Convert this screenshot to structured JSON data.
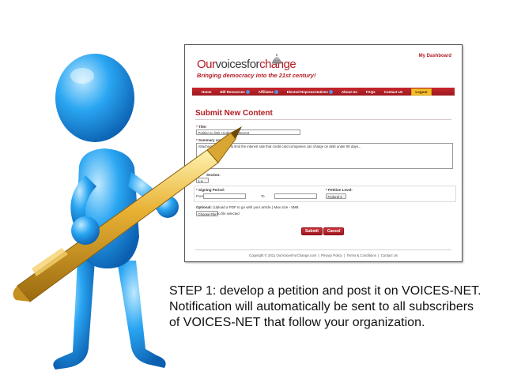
{
  "site": {
    "logo": {
      "our": "Our",
      "voices": "voices",
      "for": "for",
      "change": "change",
      "tagline": "Bringing democracy into the 21st century!"
    },
    "dashboard_link": "My Dashboard",
    "nav": [
      {
        "label": "Home",
        "badge": false
      },
      {
        "label": "Bill Resources",
        "badge": true
      },
      {
        "label": "Affiliates",
        "badge": true
      },
      {
        "label": "Elected Representatives",
        "badge": true
      },
      {
        "label": "About Us",
        "badge": false
      },
      {
        "label": "FAQs",
        "badge": false
      },
      {
        "label": "Contact Us",
        "badge": false
      }
    ],
    "logout_label": "Logout"
  },
  "form": {
    "title": "Submit New Content",
    "title_label": "Title:",
    "title_value": "Petition to limit credit card interest",
    "summary_label": "Summary comments:",
    "summary_value": "Attached is a petition to limit the interest rate that credit card companies can charge on debt under 90 days...",
    "section_label": "Section:",
    "section_value": "1",
    "signing_label": "Signing Period:",
    "from_label": "From",
    "to_label": "To",
    "petition_level_label": "Petition Level:",
    "petition_level_value": "Federal",
    "optional_label": "Optional:",
    "optional_text": "(Upload a PDF to go with your article.) Max size - 5MB",
    "choose_file_label": "Choose File",
    "no_file_text": "no file selected",
    "submit_label": "Submit",
    "cancel_label": "Cancel"
  },
  "footer": {
    "copyright": "Copyright © 2011 OurVoicesForChange.com",
    "links": [
      "Privacy Policy",
      "Terms & Conditions",
      "Contact Us"
    ],
    "separator": "|"
  },
  "caption": "STEP 1: develop a petition and post it on VOICES-NET.  Notification will automatically be sent to all subscribers of VOICES-NET that follow your organization.",
  "colors": {
    "brand_red": "#b31b23",
    "figure_blue": "#1f9ff0",
    "pen_gold": "#e0a628"
  }
}
